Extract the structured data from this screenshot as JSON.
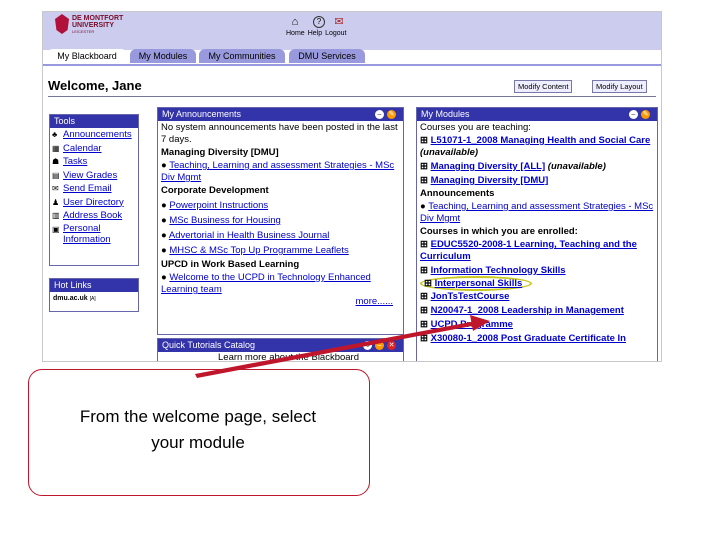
{
  "university": {
    "line1": "DE MONTFORT",
    "line2": "UNIVERSITY",
    "line3": "LEICESTER"
  },
  "top_links": [
    "Home",
    "Help",
    "Logout"
  ],
  "tabs": [
    "My Blackboard",
    "My Modules",
    "My Communities",
    "DMU Services"
  ],
  "welcome": "Welcome, Jane",
  "buttons": {
    "modify_content": "Modify Content",
    "modify_layout": "Modify Layout"
  },
  "tools": {
    "title": "Tools",
    "items": [
      {
        "label": "Announcements",
        "icon": "megaphone-icon"
      },
      {
        "label": "Calendar",
        "icon": "calendar-icon"
      },
      {
        "label": "Tasks",
        "icon": "tasks-icon"
      },
      {
        "label": "View Grades",
        "icon": "grades-icon"
      },
      {
        "label": "Send Email",
        "icon": "email-icon"
      },
      {
        "label": "User Directory",
        "icon": "user-directory-icon"
      },
      {
        "label": "Address Book",
        "icon": "address-book-icon"
      },
      {
        "label": "Personal Information",
        "icon": "personal-info-icon"
      }
    ]
  },
  "hot_links": {
    "title": "Hot Links",
    "value": "dmu.ac.uk",
    "suffix": "[A]"
  },
  "announcements": {
    "title": "My Announcements",
    "none_text": "No system announcements have been posted in the last 7 days.",
    "sections": [
      {
        "heading": "Managing Diversity [DMU]",
        "items": [
          "Teaching, Learning and assessment Strategies - MSc Div Mgmt"
        ]
      },
      {
        "heading": "Corporate Development",
        "items": [
          "Powerpoint Instructions",
          "MSc Business for Housing",
          "Advertorial in Health Business Journal",
          "MHSC & MSc Top Up Programme Leaflets"
        ]
      },
      {
        "heading": "UPCD in Work Based Learning",
        "items": [
          "Welcome to the UCPD in Technology Enhanced Learning team"
        ]
      }
    ],
    "more": "more......"
  },
  "tutorials": {
    "title": "Quick Tutorials Catalog",
    "body": "Learn more about the Blackboard Academic"
  },
  "modules": {
    "title": "My Modules",
    "teaching_heading": "Courses you are teaching:",
    "teaching": [
      {
        "name": "L51071-1_2008 Managing Health and Social Care",
        "note": "(unavailable)"
      },
      {
        "name": "Managing Diversity [ALL]",
        "note": "(unavailable)"
      },
      {
        "name": "Managing Diversity [DMU]",
        "note": ""
      }
    ],
    "announcements_heading": "Announcements",
    "announcement": "Teaching, Learning and assessment Strategies - MSc Div Mgmt",
    "enrolled_heading": "Courses in which you are enrolled:",
    "enrolled": [
      "EDUC5520-2008-1 Learning, Teaching and the Curriculum",
      "Information Technology Skills",
      "Interpersonal Skills",
      "JonTsTestCourse",
      "N20047-1_2008 Leadership in Management",
      "UCPD Programme",
      "X30080-1_2008 Post Graduate Certificate In"
    ]
  },
  "callout": {
    "line1": "From the welcome page, select",
    "line2": "your module"
  },
  "colors": {
    "banner": "#ccccee",
    "panel_header": "#3333aa",
    "link": "#0000cc",
    "callout_border": "#c0162c",
    "highlight": "#c8c820"
  }
}
